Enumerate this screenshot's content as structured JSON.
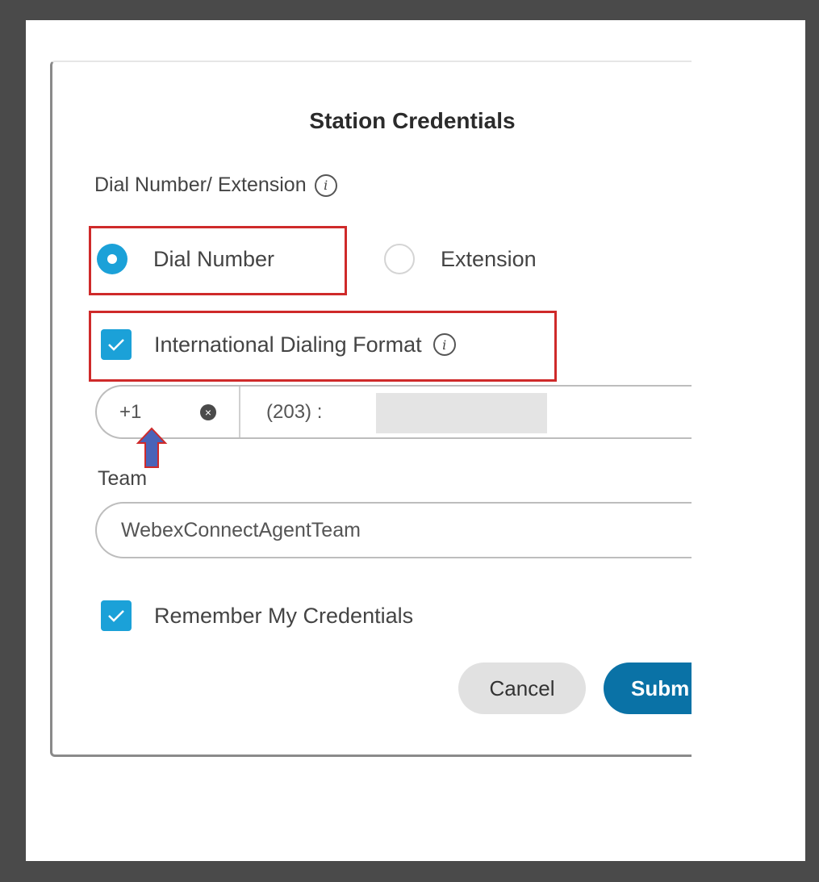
{
  "dialog": {
    "title": "Station Credentials",
    "dial_section_label": "Dial Number/ Extension",
    "options": {
      "dial_number": {
        "label": "Dial Number",
        "selected": true
      },
      "extension": {
        "label": "Extension",
        "selected": false
      }
    },
    "intl_format": {
      "label": "International Dialing Format",
      "checked": true
    },
    "phone": {
      "country_code": "+1",
      "number": "(203) :"
    },
    "team": {
      "label": "Team",
      "value": "WebexConnectAgentTeam"
    },
    "remember": {
      "label": "Remember My Credentials",
      "checked": true
    },
    "buttons": {
      "cancel": "Cancel",
      "submit": "Subm"
    }
  },
  "colors": {
    "accent": "#1ba1d8",
    "submit": "#0a72a6",
    "highlight": "#cf2a2a",
    "annotation_arrow": "#4a63b8"
  }
}
